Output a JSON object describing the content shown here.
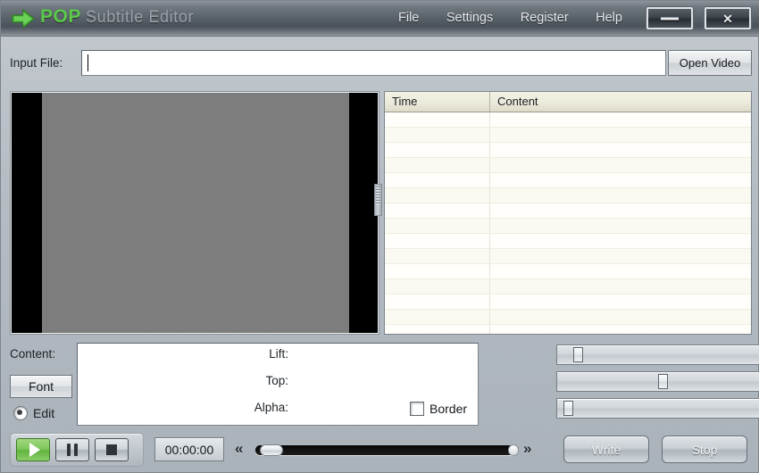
{
  "window": {
    "brand": "POP",
    "title": "Subtitle Editor",
    "arrow_icon": "green-right-arrow-icon",
    "minimize_label": "—",
    "close_label": "✕"
  },
  "menu": {
    "items": [
      {
        "label": "File"
      },
      {
        "label": "Settings"
      },
      {
        "label": "Register"
      },
      {
        "label": "Help"
      }
    ]
  },
  "input_file": {
    "label": "Input File:",
    "value": "",
    "placeholder": "",
    "open_button": "Open Video"
  },
  "video": {
    "pillarbox_color": "#000000",
    "picture_color": "#7d7d7d"
  },
  "subtitle_table": {
    "columns": [
      "Time",
      "Content"
    ],
    "rows": []
  },
  "editor": {
    "content_label": "Content:",
    "font_button": "Font",
    "edit_radio_label": "Edit",
    "edit_radio_checked": true,
    "content_value": "",
    "border_checkbox_label": "Border",
    "border_checked": false
  },
  "sliders": [
    {
      "label": "Lift:",
      "value": 8
    },
    {
      "label": "Top:",
      "value": 52
    },
    {
      "label": "Alpha:",
      "value": 3
    }
  ],
  "transport": {
    "play_icon": "play-icon",
    "pause_icon": "pause-icon",
    "stop_icon": "stop-icon",
    "timecode": "00:00:00",
    "prev_label": "«",
    "next_label": "»",
    "seek_value": 2
  },
  "actions": {
    "write_label": "Write",
    "stop_label": "Stop"
  },
  "colors": {
    "accent_green": "#5bc94a",
    "window_bg": "#b5bcc3",
    "titlebar_dark": "#575f67",
    "table_bg": "#fffef8",
    "table_header": "#eceadb"
  }
}
